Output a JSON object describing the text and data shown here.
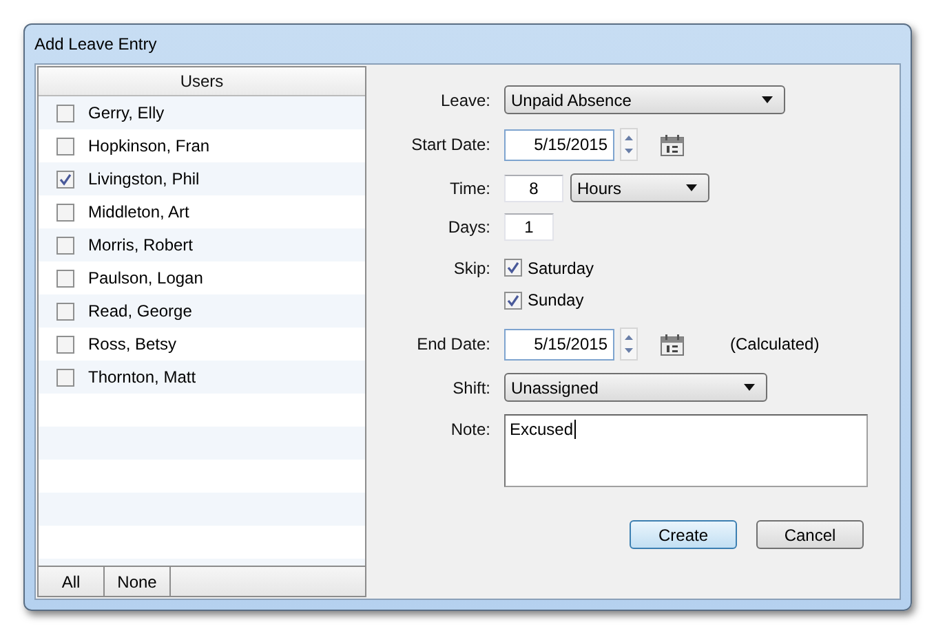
{
  "window": {
    "title": "Add Leave Entry"
  },
  "users": {
    "header": "Users",
    "rows": [
      {
        "name": "Gerry, Elly",
        "checked": false
      },
      {
        "name": "Hopkinson, Fran",
        "checked": false
      },
      {
        "name": "Livingston, Phil",
        "checked": true
      },
      {
        "name": "Middleton, Art",
        "checked": false
      },
      {
        "name": "Morris, Robert",
        "checked": false
      },
      {
        "name": "Paulson, Logan",
        "checked": false
      },
      {
        "name": "Read, George",
        "checked": false
      },
      {
        "name": "Ross, Betsy",
        "checked": false
      },
      {
        "name": "Thornton, Matt",
        "checked": false
      }
    ],
    "buttons": [
      "All",
      "None"
    ]
  },
  "form": {
    "leave": {
      "label": "Leave:",
      "value": "Unpaid Absence"
    },
    "start_date": {
      "label": "Start Date:",
      "value": "5/15/2015"
    },
    "time": {
      "label": "Time:",
      "value": "8",
      "unit": "Hours"
    },
    "days": {
      "label": "Days:",
      "value": "1"
    },
    "skip": {
      "label": "Skip:",
      "options": [
        {
          "label": "Saturday",
          "checked": true
        },
        {
          "label": "Sunday",
          "checked": true
        }
      ]
    },
    "end_date": {
      "label": "End Date:",
      "value": "5/15/2015",
      "note": "(Calculated)"
    },
    "shift": {
      "label": "Shift:",
      "value": "Unassigned"
    },
    "note": {
      "label": "Note:",
      "value": "Excused"
    },
    "buttons": [
      {
        "label": "Create",
        "default": true
      },
      {
        "label": "Cancel",
        "default": false
      }
    ]
  }
}
